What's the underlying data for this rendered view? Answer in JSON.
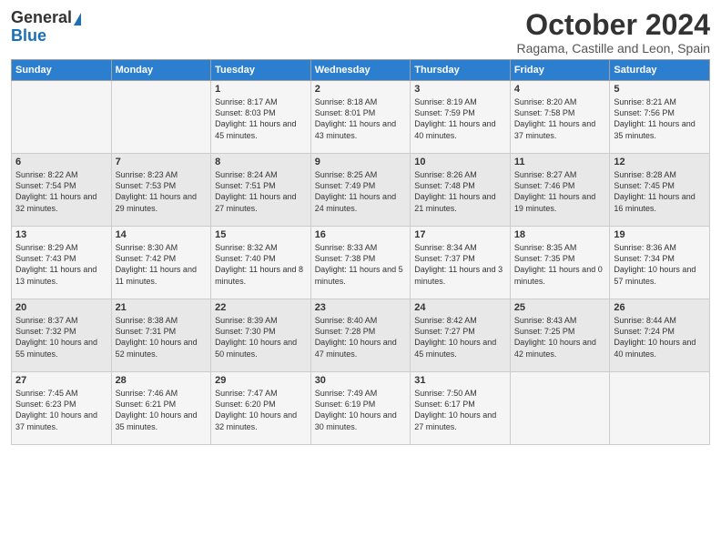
{
  "logo": {
    "general": "General",
    "blue": "Blue"
  },
  "title": "October 2024",
  "subtitle": "Ragama, Castille and Leon, Spain",
  "days_of_week": [
    "Sunday",
    "Monday",
    "Tuesday",
    "Wednesday",
    "Thursday",
    "Friday",
    "Saturday"
  ],
  "weeks": [
    [
      {
        "day": "",
        "content": ""
      },
      {
        "day": "",
        "content": ""
      },
      {
        "day": "1",
        "content": "Sunrise: 8:17 AM\nSunset: 8:03 PM\nDaylight: 11 hours and 45 minutes."
      },
      {
        "day": "2",
        "content": "Sunrise: 8:18 AM\nSunset: 8:01 PM\nDaylight: 11 hours and 43 minutes."
      },
      {
        "day": "3",
        "content": "Sunrise: 8:19 AM\nSunset: 7:59 PM\nDaylight: 11 hours and 40 minutes."
      },
      {
        "day": "4",
        "content": "Sunrise: 8:20 AM\nSunset: 7:58 PM\nDaylight: 11 hours and 37 minutes."
      },
      {
        "day": "5",
        "content": "Sunrise: 8:21 AM\nSunset: 7:56 PM\nDaylight: 11 hours and 35 minutes."
      }
    ],
    [
      {
        "day": "6",
        "content": "Sunrise: 8:22 AM\nSunset: 7:54 PM\nDaylight: 11 hours and 32 minutes."
      },
      {
        "day": "7",
        "content": "Sunrise: 8:23 AM\nSunset: 7:53 PM\nDaylight: 11 hours and 29 minutes."
      },
      {
        "day": "8",
        "content": "Sunrise: 8:24 AM\nSunset: 7:51 PM\nDaylight: 11 hours and 27 minutes."
      },
      {
        "day": "9",
        "content": "Sunrise: 8:25 AM\nSunset: 7:49 PM\nDaylight: 11 hours and 24 minutes."
      },
      {
        "day": "10",
        "content": "Sunrise: 8:26 AM\nSunset: 7:48 PM\nDaylight: 11 hours and 21 minutes."
      },
      {
        "day": "11",
        "content": "Sunrise: 8:27 AM\nSunset: 7:46 PM\nDaylight: 11 hours and 19 minutes."
      },
      {
        "day": "12",
        "content": "Sunrise: 8:28 AM\nSunset: 7:45 PM\nDaylight: 11 hours and 16 minutes."
      }
    ],
    [
      {
        "day": "13",
        "content": "Sunrise: 8:29 AM\nSunset: 7:43 PM\nDaylight: 11 hours and 13 minutes."
      },
      {
        "day": "14",
        "content": "Sunrise: 8:30 AM\nSunset: 7:42 PM\nDaylight: 11 hours and 11 minutes."
      },
      {
        "day": "15",
        "content": "Sunrise: 8:32 AM\nSunset: 7:40 PM\nDaylight: 11 hours and 8 minutes."
      },
      {
        "day": "16",
        "content": "Sunrise: 8:33 AM\nSunset: 7:38 PM\nDaylight: 11 hours and 5 minutes."
      },
      {
        "day": "17",
        "content": "Sunrise: 8:34 AM\nSunset: 7:37 PM\nDaylight: 11 hours and 3 minutes."
      },
      {
        "day": "18",
        "content": "Sunrise: 8:35 AM\nSunset: 7:35 PM\nDaylight: 11 hours and 0 minutes."
      },
      {
        "day": "19",
        "content": "Sunrise: 8:36 AM\nSunset: 7:34 PM\nDaylight: 10 hours and 57 minutes."
      }
    ],
    [
      {
        "day": "20",
        "content": "Sunrise: 8:37 AM\nSunset: 7:32 PM\nDaylight: 10 hours and 55 minutes."
      },
      {
        "day": "21",
        "content": "Sunrise: 8:38 AM\nSunset: 7:31 PM\nDaylight: 10 hours and 52 minutes."
      },
      {
        "day": "22",
        "content": "Sunrise: 8:39 AM\nSunset: 7:30 PM\nDaylight: 10 hours and 50 minutes."
      },
      {
        "day": "23",
        "content": "Sunrise: 8:40 AM\nSunset: 7:28 PM\nDaylight: 10 hours and 47 minutes."
      },
      {
        "day": "24",
        "content": "Sunrise: 8:42 AM\nSunset: 7:27 PM\nDaylight: 10 hours and 45 minutes."
      },
      {
        "day": "25",
        "content": "Sunrise: 8:43 AM\nSunset: 7:25 PM\nDaylight: 10 hours and 42 minutes."
      },
      {
        "day": "26",
        "content": "Sunrise: 8:44 AM\nSunset: 7:24 PM\nDaylight: 10 hours and 40 minutes."
      }
    ],
    [
      {
        "day": "27",
        "content": "Sunrise: 7:45 AM\nSunset: 6:23 PM\nDaylight: 10 hours and 37 minutes."
      },
      {
        "day": "28",
        "content": "Sunrise: 7:46 AM\nSunset: 6:21 PM\nDaylight: 10 hours and 35 minutes."
      },
      {
        "day": "29",
        "content": "Sunrise: 7:47 AM\nSunset: 6:20 PM\nDaylight: 10 hours and 32 minutes."
      },
      {
        "day": "30",
        "content": "Sunrise: 7:49 AM\nSunset: 6:19 PM\nDaylight: 10 hours and 30 minutes."
      },
      {
        "day": "31",
        "content": "Sunrise: 7:50 AM\nSunset: 6:17 PM\nDaylight: 10 hours and 27 minutes."
      },
      {
        "day": "",
        "content": ""
      },
      {
        "day": "",
        "content": ""
      }
    ]
  ]
}
